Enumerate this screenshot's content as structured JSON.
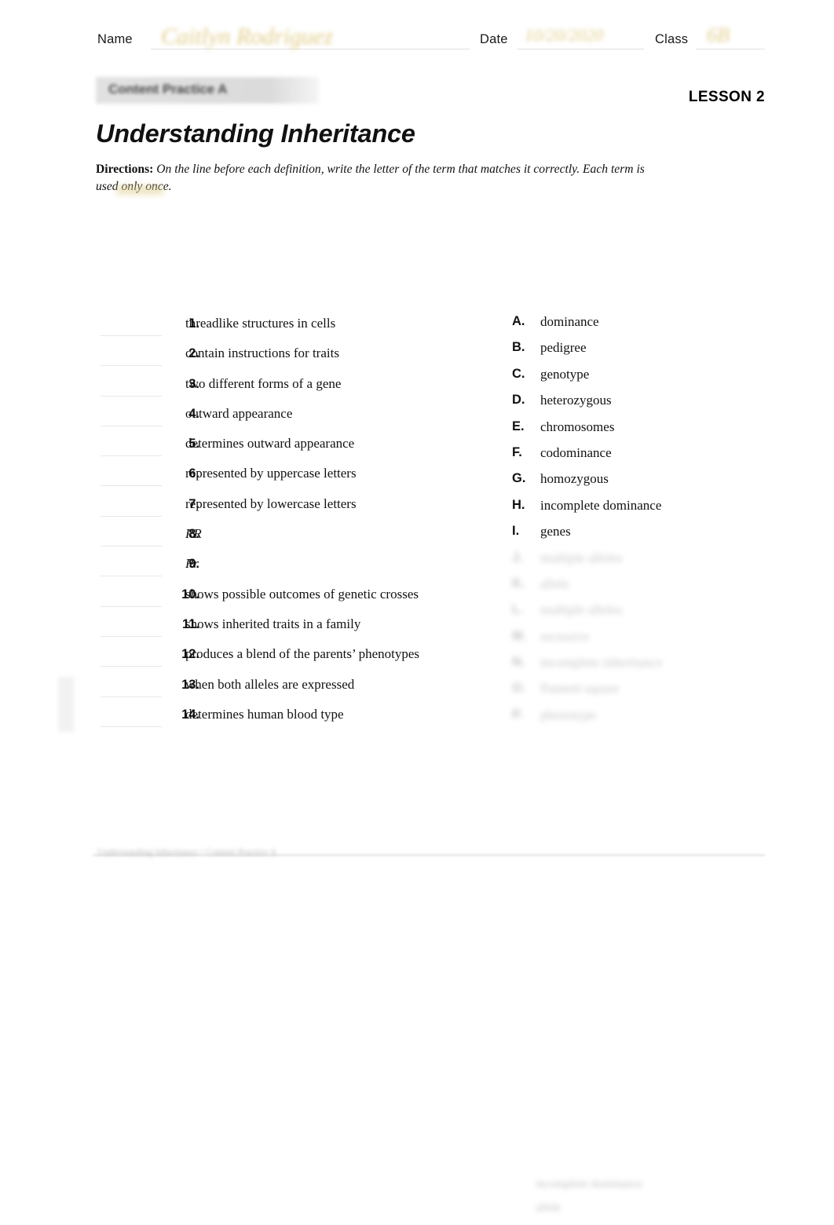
{
  "header": {
    "name_label": "Name",
    "date_label": "Date",
    "class_label": "Class",
    "name_written": "Caitlyn Rodriguez",
    "date_written": "10/20/2020",
    "class_written": "6B"
  },
  "banner": {
    "label": "Content Practice A",
    "lesson": "LESSON 2"
  },
  "title": "Understanding Inheritance",
  "directions": {
    "label": "Directions:",
    "text": "On the line before each definition, write the letter of the term that matches it correctly. Each term is used only once."
  },
  "definitions": [
    {
      "number": "1.",
      "text": "threadlike structures in cells",
      "italic": false,
      "answer": ""
    },
    {
      "number": "2.",
      "text": "contain instructions for traits",
      "italic": false,
      "answer": ""
    },
    {
      "number": "3.",
      "text": "two different forms of a gene",
      "italic": false,
      "answer": ""
    },
    {
      "number": "4.",
      "text": "outward appearance",
      "italic": false,
      "answer": ""
    },
    {
      "number": "5.",
      "text": "determines outward appearance",
      "italic": false,
      "answer": ""
    },
    {
      "number": "6.",
      "text": "represented by uppercase letters",
      "italic": false,
      "answer": ""
    },
    {
      "number": "7.",
      "text": "represented by lowercase letters",
      "italic": false,
      "answer": ""
    },
    {
      "number": "8.",
      "text": "RR",
      "italic": true,
      "answer": ""
    },
    {
      "number": "9.",
      "text": "Rr",
      "italic": true,
      "answer": ""
    },
    {
      "number": "10.",
      "text": "shows possible outcomes of genetic crosses",
      "italic": false,
      "answer": ""
    },
    {
      "number": "11.",
      "text": "shows inherited traits in a family",
      "italic": false,
      "answer": ""
    },
    {
      "number": "12.",
      "text": "produces a blend of the parents’ phenotypes",
      "italic": false,
      "answer": ""
    },
    {
      "number": "13.",
      "text": "when both alleles are expressed",
      "italic": false,
      "answer": ""
    },
    {
      "number": "14.",
      "text": "determines human blood type",
      "italic": false,
      "answer": ""
    }
  ],
  "terms": [
    {
      "letter": "A.",
      "word": "dominance",
      "obscured": false
    },
    {
      "letter": "B.",
      "word": "pedigree",
      "obscured": false
    },
    {
      "letter": "C.",
      "word": "genotype",
      "obscured": false
    },
    {
      "letter": "D.",
      "word": "heterozygous",
      "obscured": false
    },
    {
      "letter": "E.",
      "word": "chromosomes",
      "obscured": false
    },
    {
      "letter": "F.",
      "word": "codominance",
      "obscured": false
    },
    {
      "letter": "G.",
      "word": "homozygous",
      "obscured": false
    },
    {
      "letter": "H.",
      "word": "incomplete dominance",
      "obscured": false
    },
    {
      "letter": "I.",
      "word": "genes",
      "obscured": false
    },
    {
      "letter": "J.",
      "word": "multiple alleles",
      "obscured": true
    },
    {
      "letter": "K.",
      "word": "allele",
      "obscured": true
    },
    {
      "letter": "L.",
      "word": "multiple alleles",
      "obscured": true
    },
    {
      "letter": "M.",
      "word": "recessive",
      "obscured": true
    },
    {
      "letter": "N.",
      "word": "incomplete inheritance",
      "obscured": true
    },
    {
      "letter": "O.",
      "word": "Punnett square",
      "obscured": true
    },
    {
      "letter": "P.",
      "word": "phenotype",
      "obscured": true
    }
  ],
  "footer": {
    "note": "Understanding Inheritance   •   Content Practice A"
  },
  "ghost_section": {
    "items": [
      "",
      "",
      "",
      "",
      "",
      "",
      "",
      ""
    ],
    "terms": [
      "incomplete dominance",
      "allele"
    ]
  }
}
